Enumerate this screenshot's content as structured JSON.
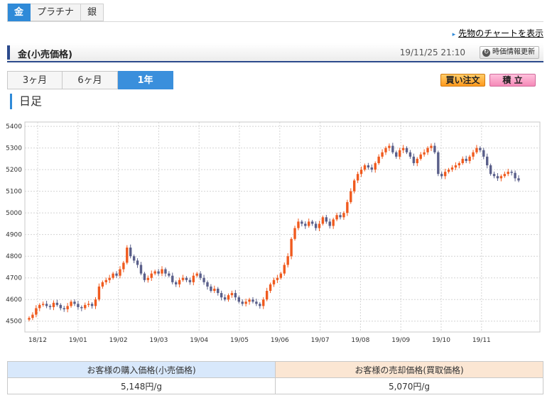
{
  "metal_tabs": [
    {
      "label": "金",
      "active": true
    },
    {
      "label": "プラチナ",
      "active": false
    },
    {
      "label": "銀",
      "active": false
    }
  ],
  "futures_link": "先物のチャートを表示",
  "title": "金(小売価格)",
  "timestamp": "19/11/25 21:10",
  "update_label": "時価情報更新",
  "period_tabs": [
    {
      "label": "3ヶ月",
      "active": false
    },
    {
      "label": "6ヶ月",
      "active": false
    },
    {
      "label": "1年",
      "active": true
    }
  ],
  "buy_button": "買い注文",
  "accumulate_button": "積 立",
  "section_heading": "日足",
  "colors": {
    "up": "#f05a1e",
    "down": "#5a5f8a",
    "accent": "#2f8ad8"
  },
  "chart_data": {
    "type": "candlestick",
    "title": "",
    "xlabel": "",
    "ylabel": "",
    "ylim": [
      4450,
      5420
    ],
    "yticks": [
      4500,
      4600,
      4700,
      4800,
      4900,
      5000,
      5100,
      5200,
      5300,
      5400
    ],
    "xticks": [
      "18/12",
      "19/01",
      "19/02",
      "19/03",
      "19/04",
      "19/05",
      "19/06",
      "19/07",
      "19/08",
      "19/09",
      "19/10",
      "19/11"
    ],
    "grid": true,
    "series": [
      {
        "values": [
          4515,
          4530,
          4560,
          4575,
          4580,
          4570,
          4565,
          4585,
          4575,
          4560,
          4555,
          4570,
          4590,
          4580,
          4565,
          4560,
          4575,
          4580,
          4570,
          4600,
          4660,
          4680,
          4690,
          4700,
          4720,
          4710,
          4740,
          4770,
          4840,
          4800,
          4780,
          4760,
          4720,
          4690,
          4700,
          4720,
          4730,
          4720,
          4740,
          4720,
          4710,
          4680,
          4670,
          4690,
          4700,
          4690,
          4680,
          4710,
          4720,
          4700,
          4680,
          4660,
          4640,
          4650,
          4630,
          4610,
          4600,
          4620,
          4630,
          4610,
          4590,
          4580,
          4590,
          4600,
          4590,
          4580,
          4570,
          4600,
          4640,
          4670,
          4690,
          4700,
          4720,
          4760,
          4800,
          4880,
          4930,
          4960,
          4950,
          4940,
          4960,
          4950,
          4930,
          4950,
          4980,
          4960,
          4940,
          4970,
          4990,
          4980,
          5000,
          5050,
          5100,
          5150,
          5180,
          5200,
          5220,
          5210,
          5200,
          5230,
          5260,
          5280,
          5300,
          5310,
          5280,
          5260,
          5290,
          5300,
          5280,
          5260,
          5230,
          5250,
          5270,
          5280,
          5300,
          5310,
          5280,
          5180,
          5170,
          5190,
          5200,
          5210,
          5220,
          5230,
          5250,
          5240,
          5260,
          5280,
          5300,
          5290,
          5260,
          5220,
          5180,
          5170,
          5160,
          5170,
          5180,
          5190,
          5185,
          5160,
          5150
        ]
      }
    ]
  },
  "price_table": {
    "buy_header": "お客様の購入価格(小売価格)",
    "sell_header": "お客様の売却価格(買取価格)",
    "buy_value": "5,148円/g",
    "sell_value": "5,070円/g"
  }
}
